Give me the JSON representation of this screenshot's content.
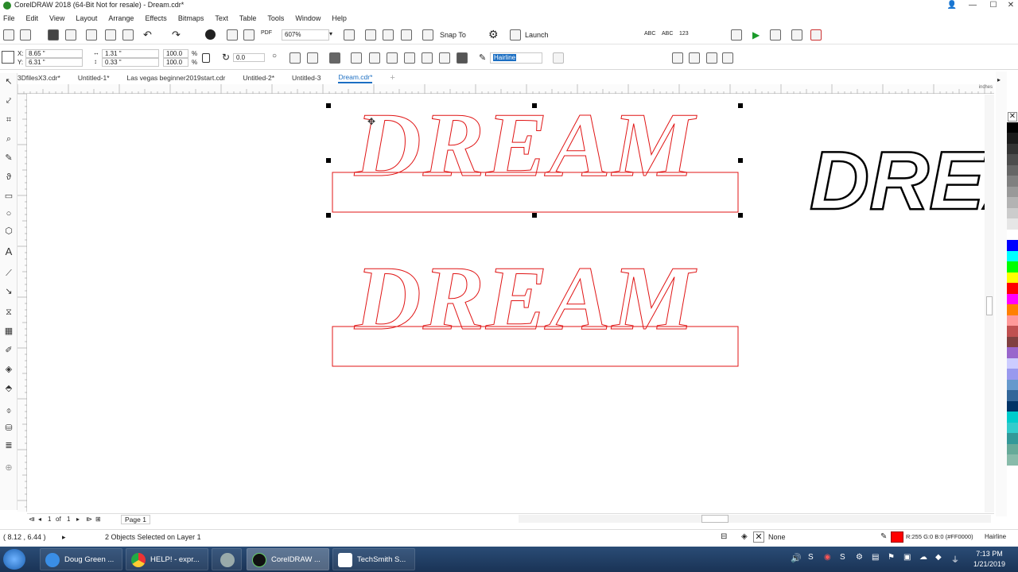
{
  "window": {
    "title": "CorelDRAW 2018 (64-Bit Not for resale) - Dream.cdr*",
    "min": "—",
    "max": "☐",
    "close": "✕"
  },
  "menu": [
    "File",
    "Edit",
    "View",
    "Layout",
    "Arrange",
    "Effects",
    "Bitmaps",
    "Text",
    "Table",
    "Tools",
    "Window",
    "Help"
  ],
  "toolbar": {
    "zoom": "607%",
    "snap_to": "Snap To",
    "launch": "Launch"
  },
  "properties": {
    "x_label": "X:",
    "x_value": "8.65 \"",
    "y_label": "Y:",
    "y_value": "6.31 \"",
    "w_value": "1.31 \"",
    "h_value": "0.33 \"",
    "scale_w": "100.0",
    "scale_h": "100.0",
    "pct": "%",
    "angle": "0.0",
    "outline": "Hairline"
  },
  "doc_tabs": [
    {
      "label": "3DfilesX3.cdr*"
    },
    {
      "label": "Untitled-1*"
    },
    {
      "label": "Las vegas beginner2019start.cdr"
    },
    {
      "label": "Untitled-2*"
    },
    {
      "label": "Untitled-3"
    },
    {
      "label": "Dream.cdr*",
      "active": true
    }
  ],
  "ruler_unit": "inches",
  "canvas": {
    "text_top": "DREAM",
    "text_bottom": "DREAM",
    "text_right": "DREA",
    "outline_color": "#e01515"
  },
  "page_nav": {
    "current": "1",
    "of": "of",
    "total": "1",
    "page_tab": "Page 1"
  },
  "status": {
    "coords": "( 8.12 , 6.44 )",
    "selection": "2 Objects Selected on Layer 1",
    "fill": "None",
    "outline_color": "R:255 G:0 B:0 (#FF0000)",
    "outline_width": "Hairline"
  },
  "palette": [
    "#ffffff",
    "#000000",
    "#1a1a1a",
    "#333333",
    "#4d4d4d",
    "#666666",
    "#808080",
    "#999999",
    "#b3b3b3",
    "#cccccc",
    "#e6e6e6",
    "#ffffff",
    "#0000ff",
    "#00ffff",
    "#00ff00",
    "#ffff00",
    "#ff0000",
    "#ff00ff",
    "#ff8000",
    "#ff9999",
    "#c05050",
    "#804040",
    "#9966cc",
    "#ccccff",
    "#9999ee",
    "#6699cc",
    "#336699",
    "#003366",
    "#00cccc",
    "#33cccc",
    "#339999",
    "#66aa99",
    "#88bbaa"
  ],
  "taskbar": {
    "items": [
      "Doug Green ...",
      "HELP! - expr...",
      "",
      "CorelDRAW ...",
      "TechSmith S..."
    ],
    "time": "7:13 PM",
    "date": "1/21/2019"
  }
}
